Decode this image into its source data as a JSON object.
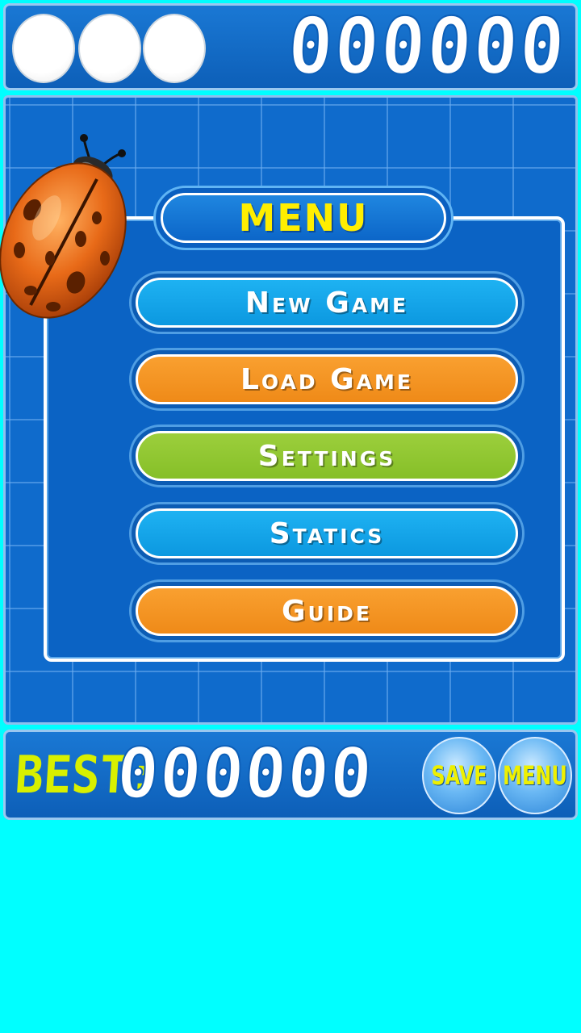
{
  "lives": {
    "count": 3
  },
  "top_score": "000000",
  "menu": {
    "title": "MENU",
    "items": [
      {
        "label": "New Game",
        "color": "blue"
      },
      {
        "label": "Load Game",
        "color": "orange"
      },
      {
        "label": "Settings",
        "color": "green"
      },
      {
        "label": "Statics",
        "color": "blue"
      },
      {
        "label": "Guide",
        "color": "orange"
      }
    ]
  },
  "bottom_bar": {
    "best_label": "BEST:",
    "best_score": "000000",
    "save_label": "SAVE",
    "menu_label": "MENU"
  },
  "colors": {
    "panel_blue": "#0f6bcc",
    "button_blue": "#1eb2f2",
    "button_orange": "#f9a030",
    "button_green": "#9ccf3c",
    "title_yellow": "#ffee00",
    "background_cyan": "#00ffff"
  }
}
